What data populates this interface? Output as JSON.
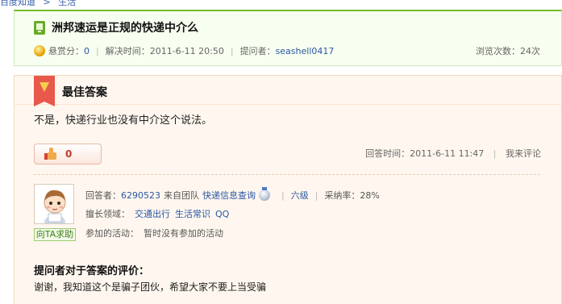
{
  "breadcrumb": [
    "百度知道",
    ">",
    "生活"
  ],
  "question": {
    "title": "洲邦速运是正规的快递中介么",
    "reward_label": "悬赏分：",
    "reward_value": "0",
    "solved_time": "解决时间：2011-6-11 20:50",
    "asker_label": "提问者：",
    "asker_name": "seashell0417",
    "views": "浏览次数：24次"
  },
  "best_answer": {
    "heading": "最佳答案",
    "text": "不是，快递行业也没有中介这个说法。",
    "like_count": "0",
    "answer_time": "回答时间：2011-6-11 11:47",
    "comment_link": "我来评论",
    "help_button": "向TA求助",
    "answerer_label": "回答者：",
    "answerer_name": "6290523",
    "team_prefix": "来自团队",
    "team_name": "快递信息查询",
    "level": "六级",
    "accept_rate": "采纳率：28%",
    "expertise_label": "擅长领域：",
    "expertise": [
      "交通出行",
      "生活常识",
      "QQ"
    ],
    "activity_label": "参加的活动：",
    "activity_value": "暂时没有参加的活动"
  },
  "evaluation": {
    "title": "提问者对于答案的评价：",
    "text": "谢谢，我知道这个是骗子团伙，希望大家不要上当受骗"
  },
  "colors": {
    "accent_green": "#75bd2b",
    "link_blue": "#2a56a4",
    "answer_bg": "#fff7ef"
  },
  "icons": [
    "phone-icon",
    "coin-icon",
    "best-answer-banner-icon",
    "thumbs-up-icon",
    "medal-icon",
    "avatar-icon"
  ]
}
